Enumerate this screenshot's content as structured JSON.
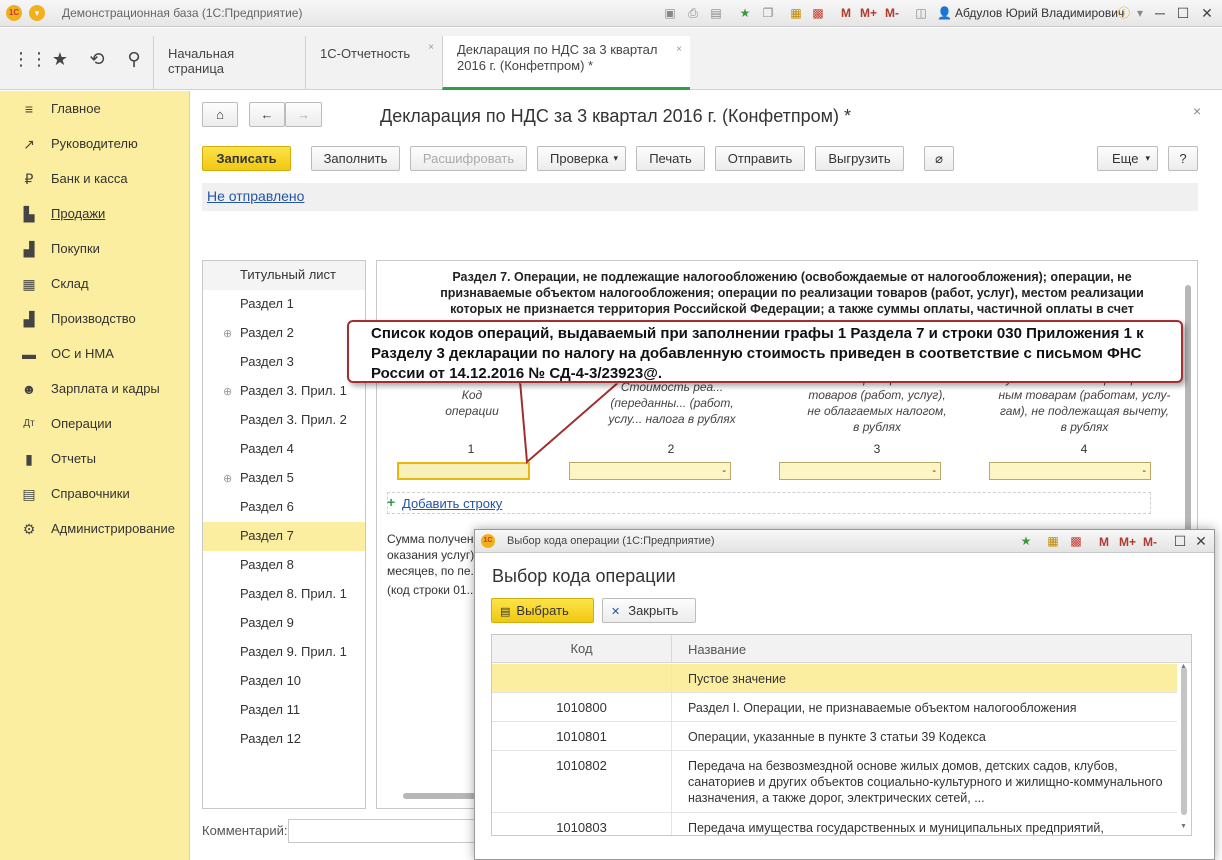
{
  "window": {
    "title": "Демонстрационная база (1С:Предприятие)",
    "user": "Абдулов Юрий Владимирович",
    "app_badge": "1С",
    "m_buttons": [
      "M",
      "M+",
      "M-"
    ]
  },
  "tabs": [
    {
      "label": "Начальная страница"
    },
    {
      "label": "1С-Отчетность"
    },
    {
      "label": "Декларация по НДС за 3 квартал 2016 г. (Конфетпром) *"
    }
  ],
  "sidebar": {
    "items": [
      {
        "label": "Главное",
        "icon": "menu-icon"
      },
      {
        "label": "Руководителю",
        "icon": "trend-icon"
      },
      {
        "label": "Банк и касса",
        "icon": "ruble-icon"
      },
      {
        "label": "Продажи",
        "icon": "cart-icon"
      },
      {
        "label": "Покупки",
        "icon": "basket-icon"
      },
      {
        "label": "Склад",
        "icon": "warehouse-icon"
      },
      {
        "label": "Производство",
        "icon": "factory-icon"
      },
      {
        "label": "ОС и НМА",
        "icon": "truck-icon"
      },
      {
        "label": "Зарплата и кадры",
        "icon": "people-icon"
      },
      {
        "label": "Операции",
        "icon": "debit-credit-icon"
      },
      {
        "label": "Отчеты",
        "icon": "bar-chart-icon"
      },
      {
        "label": "Справочники",
        "icon": "book-icon"
      },
      {
        "label": "Администрирование",
        "icon": "gear-icon"
      }
    ]
  },
  "document": {
    "title": "Декларация по НДС за 3 квартал 2016 г. (Конфетпром) *",
    "buttons": {
      "save": "Записать",
      "fill": "Заполнить",
      "decode": "Расшифровать",
      "check": "Проверка",
      "print": "Печать",
      "send": "Отправить",
      "export": "Выгрузить",
      "more": "Еще",
      "help": "?"
    },
    "status_link": "Не отправлено",
    "comment_label": "Комментарий:"
  },
  "sections": [
    {
      "label": "Титульный лист",
      "expandable": false
    },
    {
      "label": "Раздел 1",
      "expandable": false
    },
    {
      "label": "Раздел 2",
      "expandable": true
    },
    {
      "label": "Раздел 3",
      "expandable": false
    },
    {
      "label": "Раздел 3. Прил. 1",
      "expandable": true
    },
    {
      "label": "Раздел 3. Прил. 2",
      "expandable": false
    },
    {
      "label": "Раздел 4",
      "expandable": false
    },
    {
      "label": "Раздел 5",
      "expandable": true
    },
    {
      "label": "Раздел 6",
      "expandable": false
    },
    {
      "label": "Раздел 7",
      "expandable": false,
      "active": true
    },
    {
      "label": "Раздел 8",
      "expandable": false
    },
    {
      "label": "Раздел 8. Прил. 1",
      "expandable": false
    },
    {
      "label": "Раздел 9",
      "expandable": false
    },
    {
      "label": "Раздел 9. Прил. 1",
      "expandable": false
    },
    {
      "label": "Раздел 10",
      "expandable": false
    },
    {
      "label": "Раздел 11",
      "expandable": false
    },
    {
      "label": "Раздел 12",
      "expandable": false
    }
  ],
  "section7": {
    "heading_lines": [
      "Раздел 7. Операции, не подлежащие налогообложению (освобождаемые от налогообложения); операции, не",
      "признаваемые объектом налогообложения; операции по реализации товаров (работ, услуг), местом реализации",
      "которых не признается территория Российской Федерации; а также суммы оплаты, частичной оплаты в счет"
    ],
    "columns": [
      {
        "lines": [
          "Код",
          "операции"
        ],
        "num": "1"
      },
      {
        "lines": [
          "Стоимость реа...",
          "(переданны...      (работ,",
          "услу...         налога в рублях"
        ],
        "num": "2"
      },
      {
        "lines": [
          "...мость приобретенных",
          "товаров (работ, услуг),",
          "не облагаемых налогом,",
          "в рублях"
        ],
        "num": "3"
      },
      {
        "lines": [
          "Сумма налога по приобретен-",
          "ным товарам (работам, услу-",
          "гам), не подлежащая вычету,",
          "в рублях"
        ],
        "num": "4"
      }
    ],
    "field_dash": "-",
    "add_row": "Добавить строку",
    "summa_lines": [
      "Сумма получен...",
      "оказания услуг)...",
      "месяцев, по пе...",
      "(код строки 01..."
    ]
  },
  "callout": {
    "text": "Список кодов операций, выдаваемый при заполнении графы 1 Раздела 7 и строки 030 Приложения 1 к Разделу 3 декларации по налогу на добавленную стоимость приведен в соответствие с письмом ФНС России от 14.12.2016 № СД-4-3/23923@."
  },
  "dialog": {
    "window_title": "Выбор кода операции  (1С:Предприятие)",
    "heading": "Выбор кода операции",
    "select_button": "Выбрать",
    "close_button": "Закрыть",
    "columns": {
      "code": "Код",
      "name": "Название"
    },
    "rows": [
      {
        "code": "",
        "name": "Пустое значение",
        "selected": true
      },
      {
        "code": "1010800",
        "name": "Раздел I. Операции, не признаваемые объектом налогообложения"
      },
      {
        "code": "1010801",
        "name": "Операции, указанные в пункте 3 статьи 39 Кодекса"
      },
      {
        "code": "1010802",
        "name": "Передача на безвозмездной основе жилых домов, детских садов, клубов, санаториев и других объектов социально-культурного и жилищно-коммунального назначения, а также дорог, электрических сетей, ..."
      },
      {
        "code": "1010803",
        "name": "Передача имущества государственных и муниципальных предприятий,"
      }
    ]
  },
  "colors": {
    "accent_yellow": "#f2c811",
    "sidebar_bg": "#fbeea0",
    "link_blue": "#2354a6",
    "callout_border": "#a03030",
    "active_tab_underline": "#2e9e4a"
  }
}
